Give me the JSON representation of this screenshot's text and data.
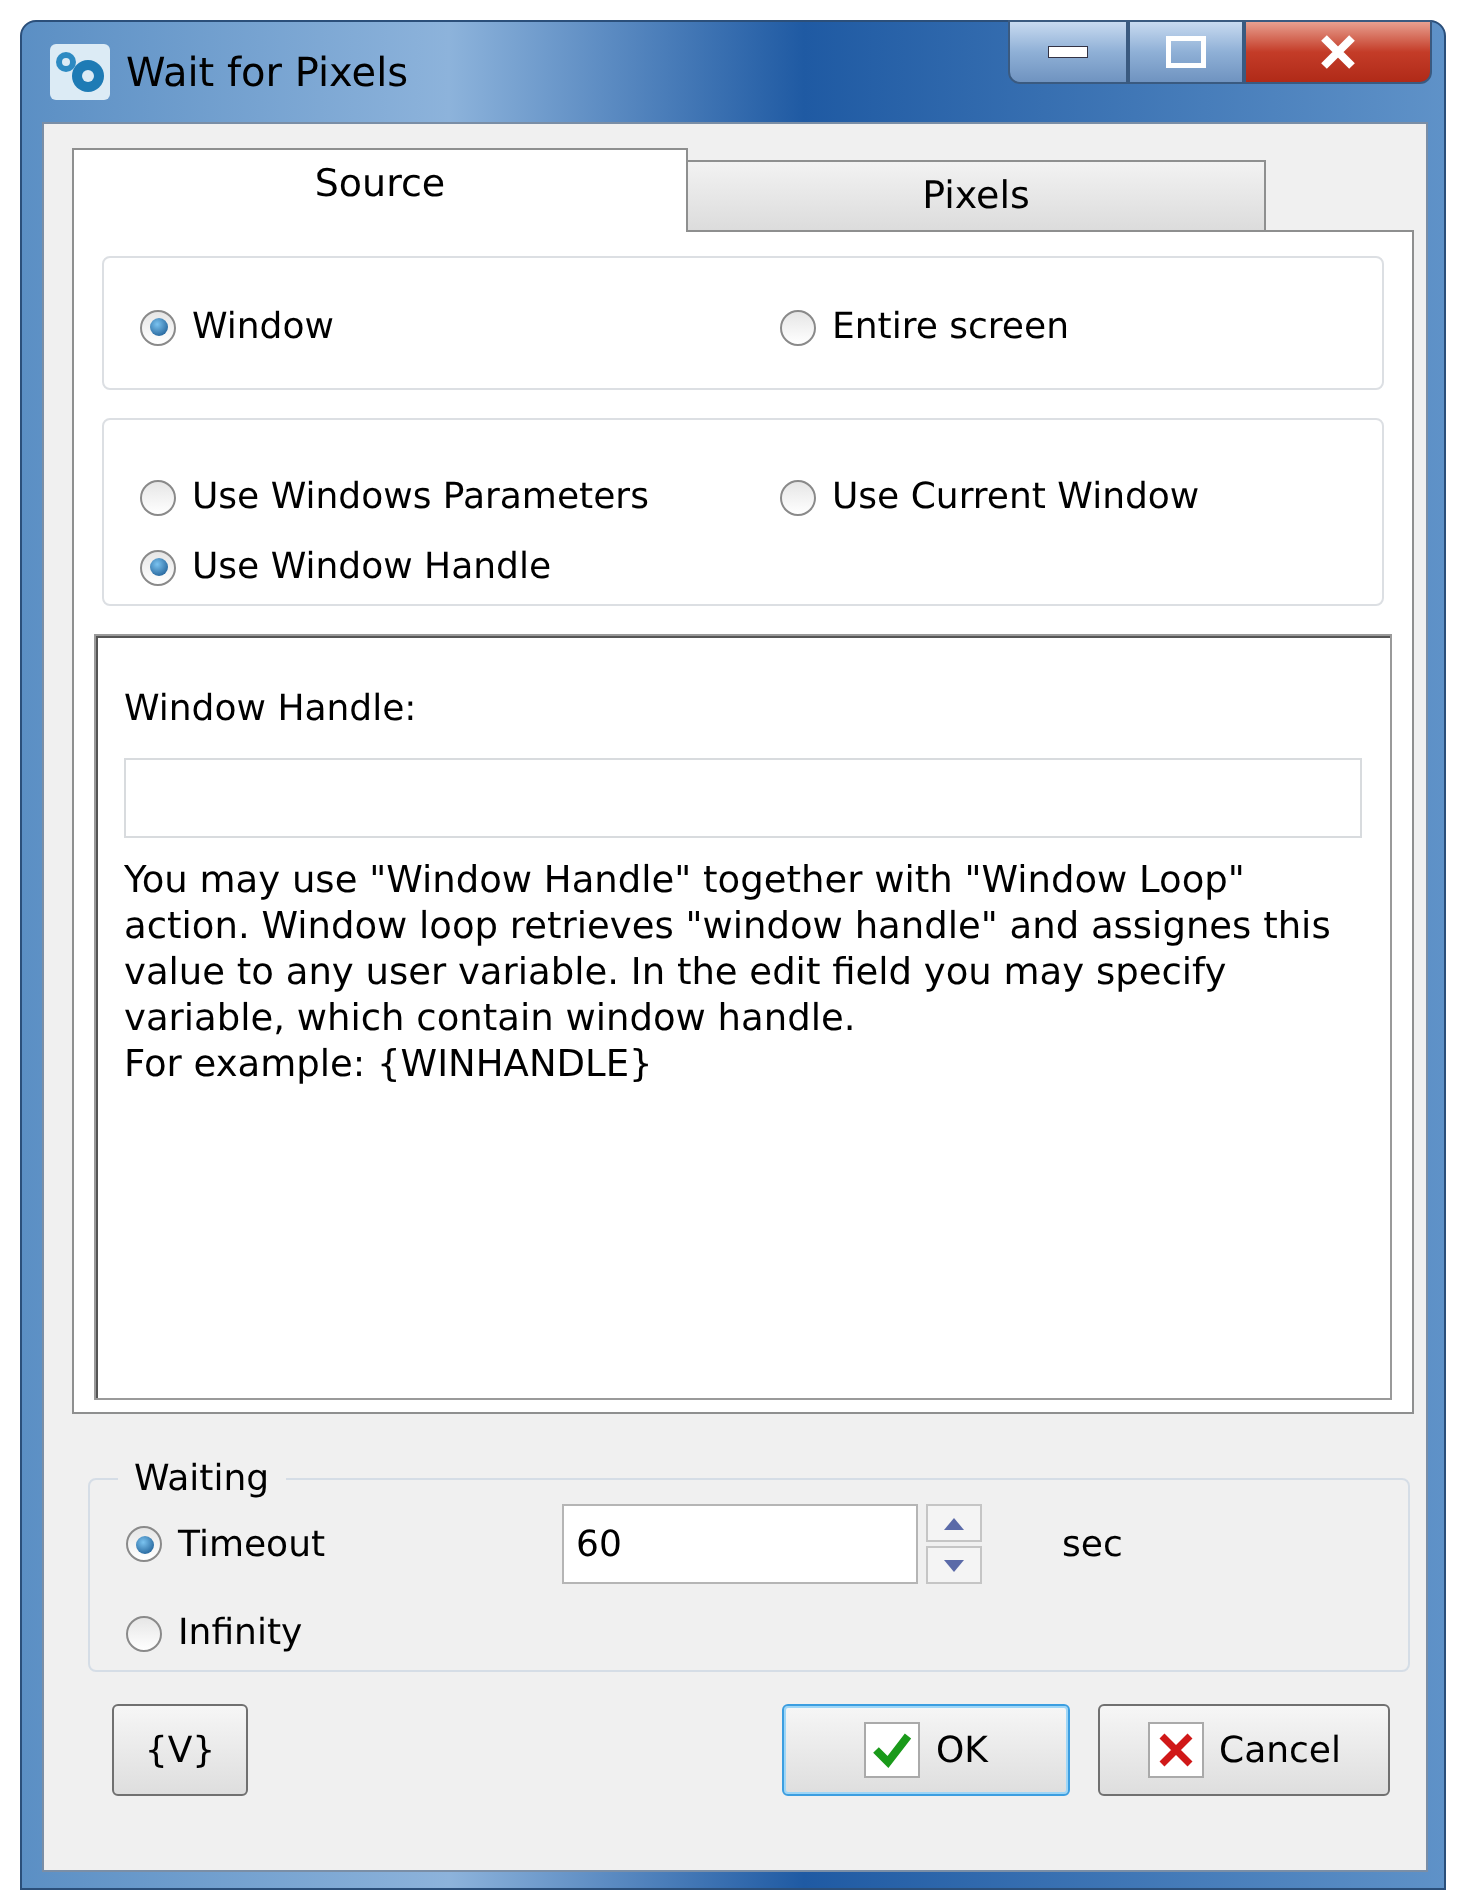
{
  "window": {
    "title": "Wait for Pixels"
  },
  "tabs": [
    {
      "label": "Source",
      "selected": true
    },
    {
      "label": "Pixels",
      "selected": false
    }
  ],
  "source_group": [
    {
      "label": "Window",
      "selected": true
    },
    {
      "label": "Entire screen",
      "selected": false
    }
  ],
  "window_mode_group": [
    {
      "label": "Use Windows Parameters",
      "selected": false
    },
    {
      "label": "Use Current Window",
      "selected": false
    },
    {
      "label": "Use Window Handle",
      "selected": true
    }
  ],
  "handle_panel": {
    "label": "Window Handle:",
    "description": "You may use \"Window Handle\" together with \"Window Loop\" action. Window loop retrieves \"window handle\" and assignes this value to any user variable. In the edit field you may specify variable, which contain window handle.",
    "example": "For example: {WINHANDLE}"
  },
  "waiting": {
    "title": "Waiting",
    "options": [
      {
        "label": "Timeout",
        "selected": true
      },
      {
        "label": "Infinity",
        "selected": false
      }
    ],
    "timeout_value": "60",
    "unit": "sec"
  },
  "buttons": {
    "variables": "{V}",
    "ok": "OK",
    "cancel": "Cancel"
  }
}
